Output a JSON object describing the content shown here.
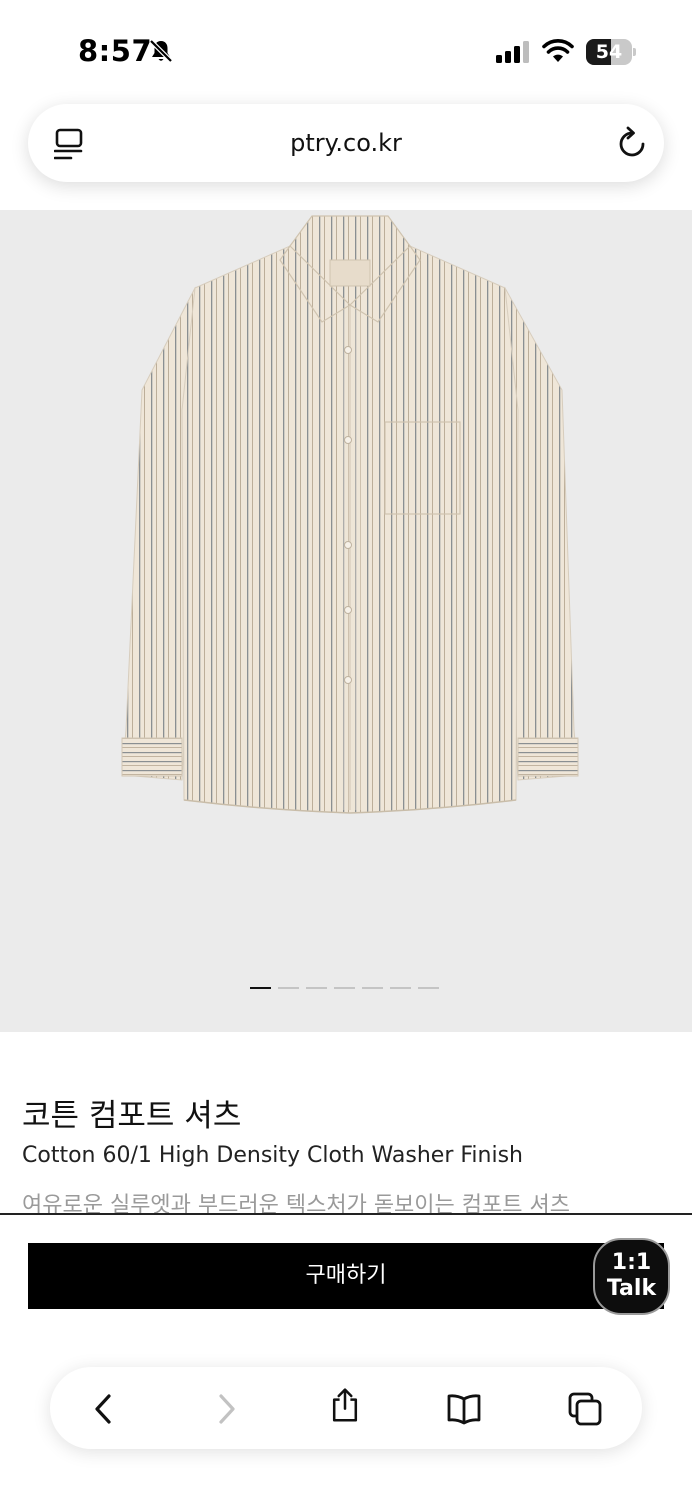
{
  "status_bar": {
    "time": "8:57",
    "battery": "54",
    "battery_level": 0.54,
    "icons": [
      "bell-slash-icon",
      "cellular-signal-icon",
      "wifi-icon",
      "battery-icon"
    ]
  },
  "browser": {
    "url": "ptry.co.kr",
    "icons": [
      "reader-icon",
      "reload-icon"
    ]
  },
  "product": {
    "title": "코튼 컴포트 셔츠",
    "subtitle": "Cotton 60/1 High Density Cloth Washer Finish",
    "description": "여유로운 실루엣과 부드러운 텍스처가 돋보이는 컴포트 셔츠",
    "image_count": 7,
    "image_index": 0
  },
  "actions": {
    "buy_label": "구매하기",
    "talk_line1": "1:1",
    "talk_line2": "Talk"
  },
  "toolbar": {
    "icons": [
      "back-icon",
      "forward-icon",
      "share-icon",
      "bookmarks-icon",
      "tabs-icon"
    ]
  }
}
